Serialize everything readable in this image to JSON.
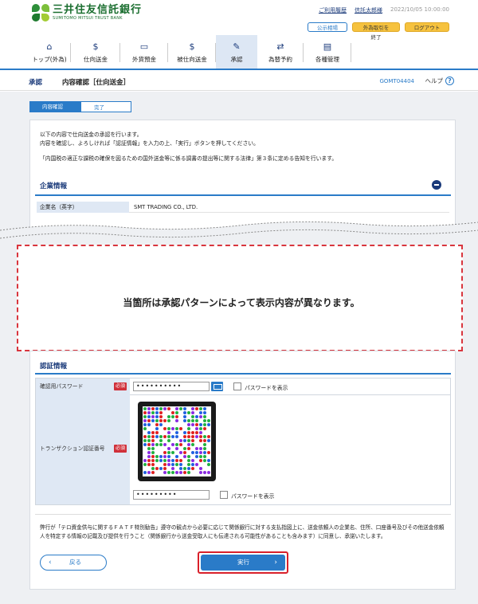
{
  "header": {
    "bank_name_jp": "三井住友信託銀行",
    "bank_name_en": "SUMITOMO MITSUI TRUST BANK",
    "usage_history": "ご利用履歴",
    "user_name": "信託太郎様",
    "timestamp": "2022/10/05 10:00:00",
    "disclosure_button": "公示相場",
    "end_fx_button": "外為取引を終了",
    "logout_button": "ログアウト"
  },
  "nav": {
    "items": [
      {
        "label": "トップ(外為)",
        "icon": "home-icon"
      },
      {
        "label": "仕向送金",
        "icon": "outbound-remittance-icon"
      },
      {
        "label": "外貨預金",
        "icon": "fx-deposit-icon"
      },
      {
        "label": "被仕向送金",
        "icon": "inbound-remittance-icon"
      },
      {
        "label": "承認",
        "icon": "approval-icon"
      },
      {
        "label": "為替予約",
        "icon": "fx-contract-icon"
      },
      {
        "label": "各種管理",
        "icon": "management-icon"
      }
    ],
    "active_index": 4
  },
  "page": {
    "category": "承認",
    "title": "内容確認［仕向送金］",
    "screen_code": "GOMT04404",
    "help_label": "ヘルプ"
  },
  "steps": [
    "内容確認",
    "完了"
  ],
  "intro": {
    "line1": "以下の内容で仕向送金の承認を行います。",
    "line2": "内容を確認し、よろしければ「認証情報」を入力の上、「実行」ボタンを押してください。",
    "note": "「内国税の適正な課税の確保を図るための国外送金等に係る調書の提出等に関する法律」第３条に定める告知を行います。"
  },
  "company_section": {
    "title": "企業情報",
    "rows": [
      {
        "label": "企業名（英字）",
        "value": "SMT TRADING CO., LTD."
      }
    ]
  },
  "notice": {
    "text": "当箇所は承認パターンによって表示内容が異なります。"
  },
  "auth_section": {
    "title": "認証情報",
    "password_label": "確認用パスワード",
    "required_badge": "必須",
    "password_value": "••••••••••",
    "show_password_label": "パスワードを表示",
    "transaction_label": "トランザクション認証番号",
    "tx_value": "•••••••••"
  },
  "disclaimer": "弊行が「テロ資金供与に関するＦＡＴＦ特別勧告」遵守の観点から必要に応じて関係銀行に対する支払指図上に、送金依頼人の企業名、住所、口座番号及びその他送金依頼人を特定する情報の記載及び提供を行うこと（関係銀行から送金受取人にも伝達される可能性があることも含みます）に同意し、承諾いたします。",
  "buttons": {
    "back": "戻る",
    "execute": "実行"
  },
  "colors": {
    "brand_green": "#1a6e2f",
    "accent_blue": "#2a7bc8",
    "required_red": "#d0303a",
    "highlight_red": "#d9202a"
  }
}
